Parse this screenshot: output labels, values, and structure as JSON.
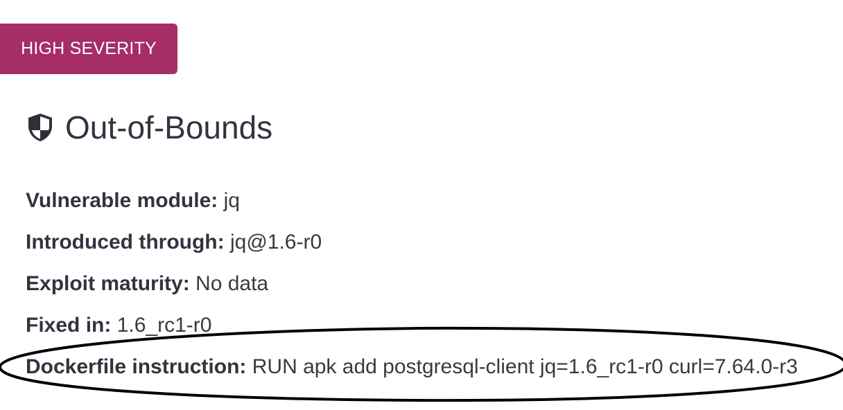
{
  "severity_badge": {
    "label": "HIGH SEVERITY",
    "color": "#a62d68"
  },
  "vulnerability": {
    "icon": "shield-icon",
    "title": "Out-of-Bounds"
  },
  "details": [
    {
      "label": "Vulnerable module:",
      "value": "jq"
    },
    {
      "label": "Introduced through:",
      "value": "jq@1.6-r0"
    },
    {
      "label": "Exploit maturity:",
      "value": "No data"
    },
    {
      "label": "Fixed in:",
      "value": "1.6_rc1-r0"
    },
    {
      "label": "Dockerfile instruction:",
      "value": "RUN apk add postgresql-client jq=1.6_rc1-r0 curl=7.64.0-r3"
    }
  ],
  "annotation": {
    "shape": "ellipse",
    "color": "#000000",
    "target": "Dockerfile instruction"
  }
}
